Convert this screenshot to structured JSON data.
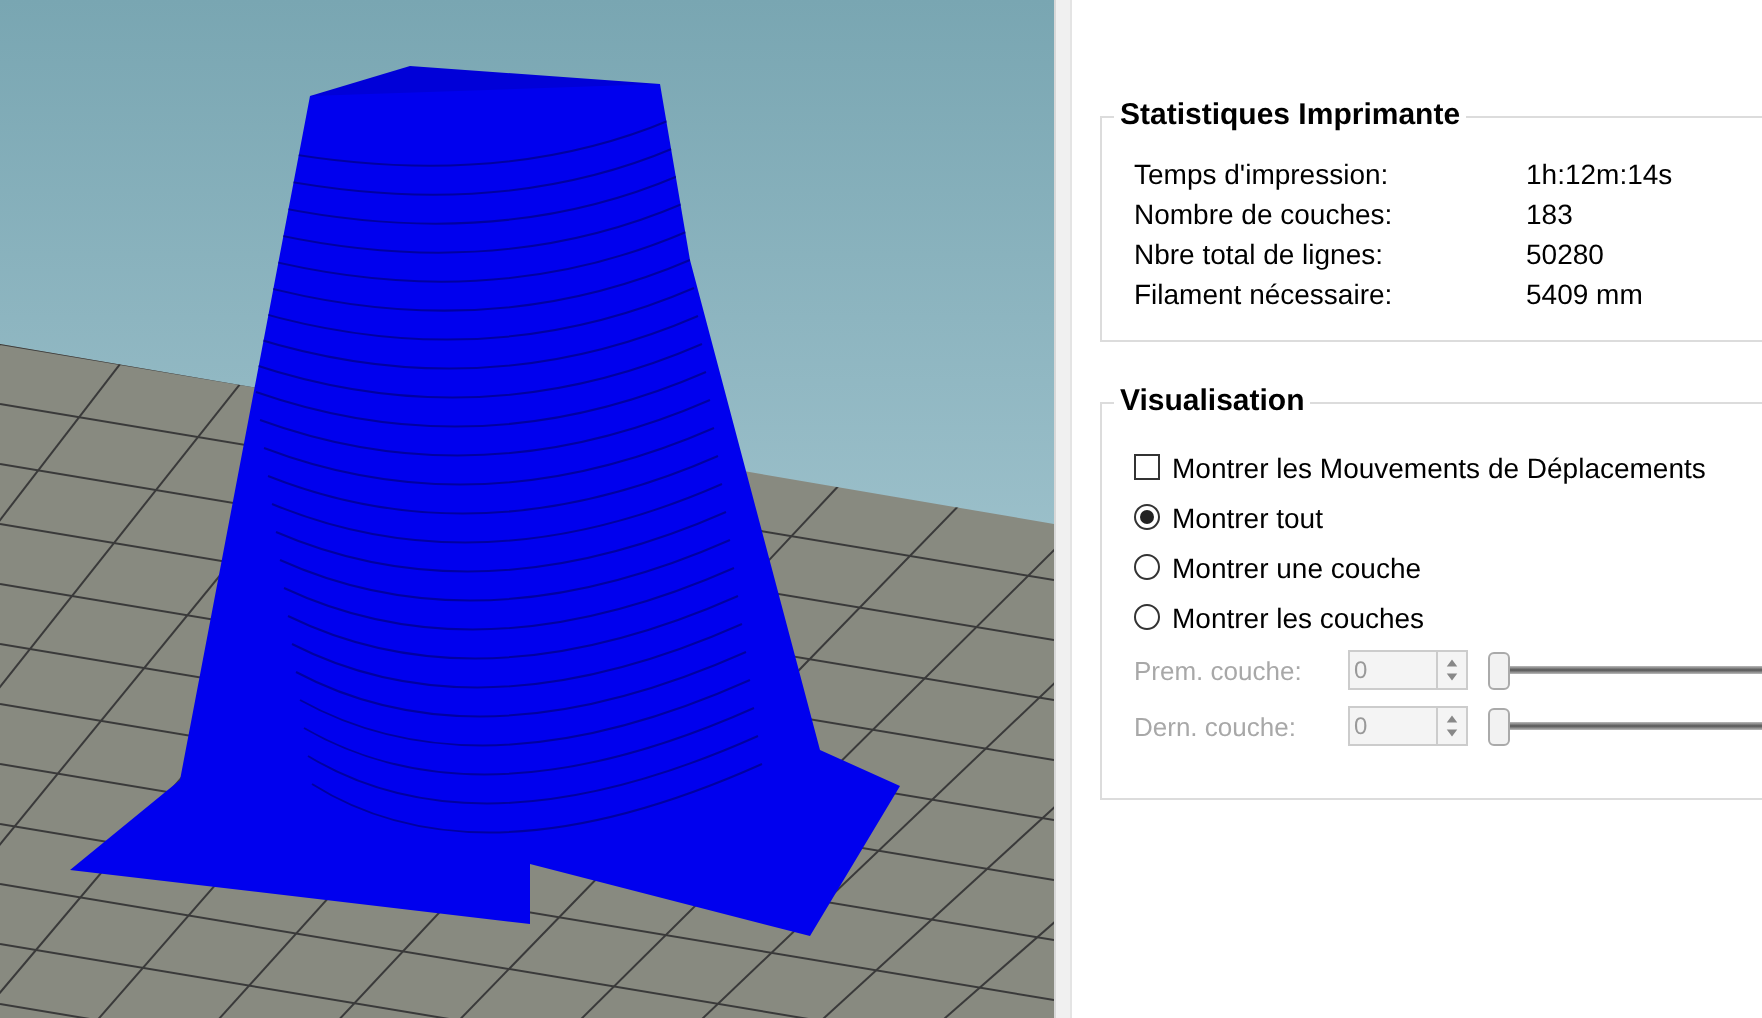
{
  "statistics": {
    "title": "Statistiques Imprimante",
    "rows": [
      {
        "label": "Temps d'impression:",
        "value": "1h:12m:14s"
      },
      {
        "label": "Nombre de couches:",
        "value": "183"
      },
      {
        "label": "Nbre total de lignes:",
        "value": "50280"
      },
      {
        "label": "Filament nécessaire:",
        "value": "5409 mm"
      }
    ]
  },
  "visualisation": {
    "title": "Visualisation",
    "options": [
      {
        "kind": "checkbox",
        "label": "Montrer les Mouvements de Déplacements",
        "checked": false
      },
      {
        "kind": "radio",
        "label": "Montrer tout",
        "selected": true
      },
      {
        "kind": "radio",
        "label": "Montrer une couche",
        "selected": false
      },
      {
        "kind": "radio",
        "label": "Montrer les couches",
        "selected": false
      }
    ],
    "layer_controls": [
      {
        "label": "Prem. couche:",
        "value": "0",
        "disabled": true,
        "level": 0
      },
      {
        "label": "Dern. couche:",
        "value": "0",
        "disabled": true,
        "level": 0
      }
    ]
  }
}
